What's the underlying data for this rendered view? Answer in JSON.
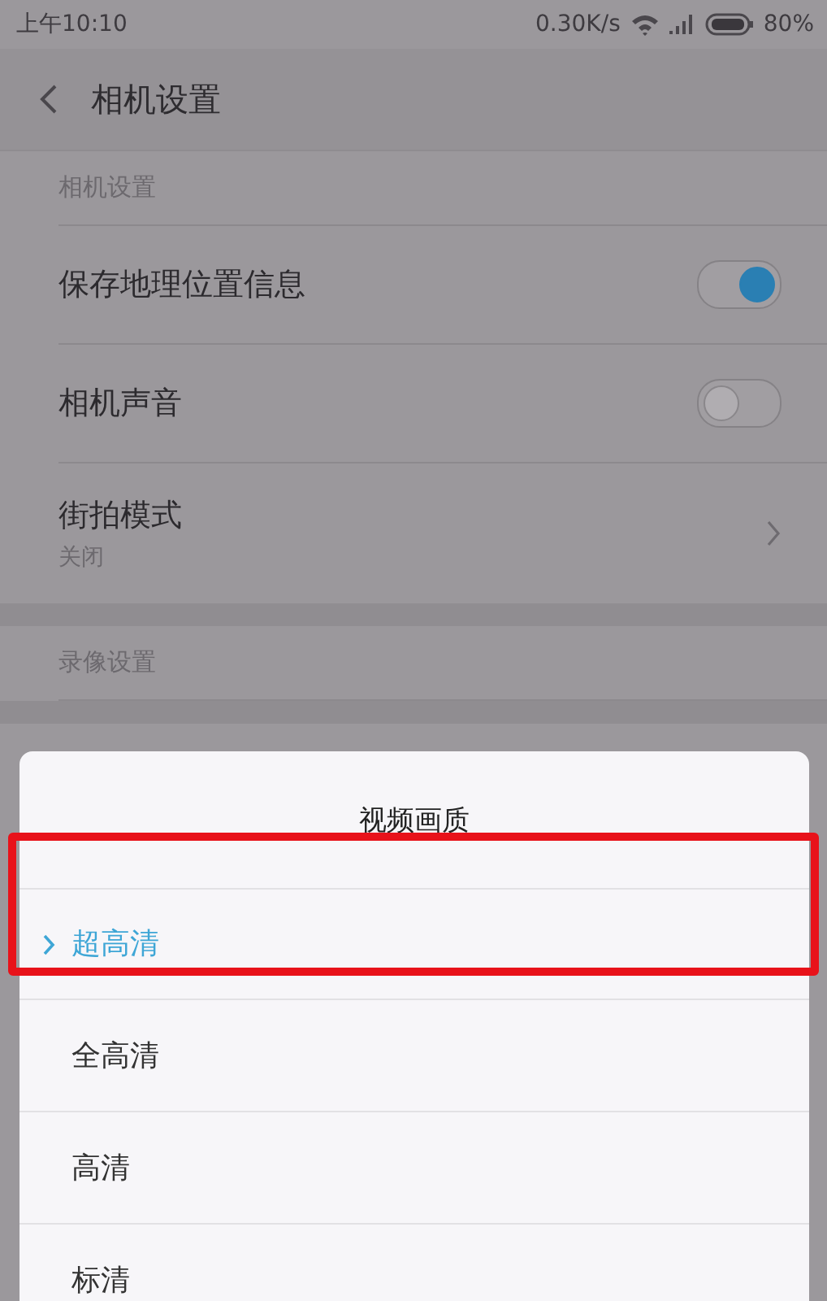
{
  "status_bar": {
    "time": "上午10:10",
    "speed": "0.30K/s",
    "battery": "80%"
  },
  "header": {
    "title": "相机设置"
  },
  "sections": [
    {
      "title": "相机设置",
      "items": [
        {
          "kind": "toggle",
          "label": "保存地理位置信息",
          "on": true
        },
        {
          "kind": "toggle",
          "label": "相机声音",
          "on": false
        },
        {
          "kind": "link",
          "label": "街拍模式",
          "value": "关闭"
        }
      ]
    },
    {
      "title": "录像设置"
    }
  ],
  "sheet": {
    "title": "视频画质",
    "options": [
      {
        "label": "超高清",
        "selected": true
      },
      {
        "label": "全高清",
        "selected": false
      },
      {
        "label": "高清",
        "selected": false
      },
      {
        "label": "标清",
        "selected": false
      }
    ]
  }
}
